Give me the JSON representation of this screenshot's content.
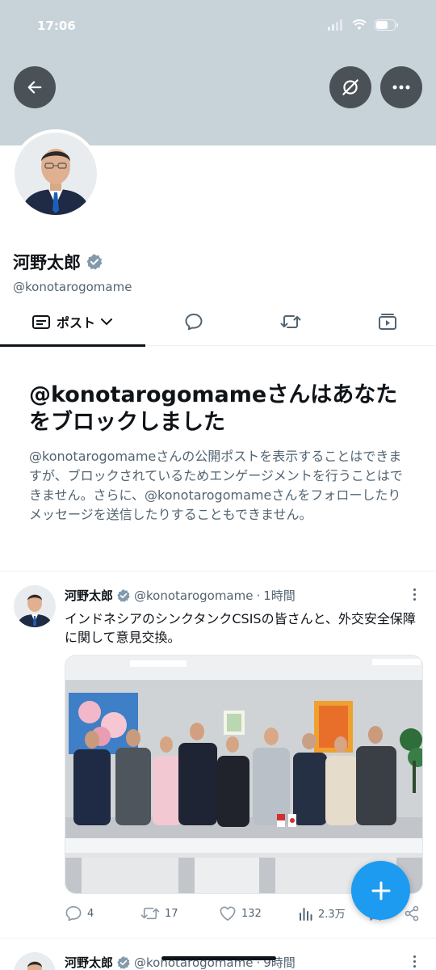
{
  "status_bar": {
    "time": "17:06"
  },
  "profile": {
    "display_name": "河野太郎",
    "handle": "@konotarogomame"
  },
  "tabs": [
    {
      "label": "ポスト",
      "icon": "posts-icon"
    },
    {
      "icon": "reply-bubble-icon"
    },
    {
      "icon": "repost-icon"
    },
    {
      "icon": "media-icon"
    }
  ],
  "block_notice": {
    "title": "@konotarogomameさんはあなたをブロックしました",
    "description": "@konotarogomameさんの公開ポストを表示することはできますが、ブロックされているためエンゲージメントを行うことはできません。さらに、@konotarogomameさんをフォローしたりメッセージを送信したりすることもできません。"
  },
  "posts": [
    {
      "name": "河野太郎",
      "handle": "@konotarogomame",
      "separator": "·",
      "time": "1時間",
      "text": "インドネシアのシンクタンクCSISの皆さんと、外交安全保障に関して意見交換。",
      "stats": {
        "replies": "4",
        "reposts": "17",
        "likes": "132",
        "views": "2.3万"
      }
    },
    {
      "name": "河野太郎",
      "handle": "@konotarogomame",
      "separator": "·",
      "time": "9時間"
    }
  ],
  "colors": {
    "banner": "#c8d2d9",
    "accent": "#1d9bf0",
    "verified": "#829aab",
    "text_secondary": "#536471"
  }
}
